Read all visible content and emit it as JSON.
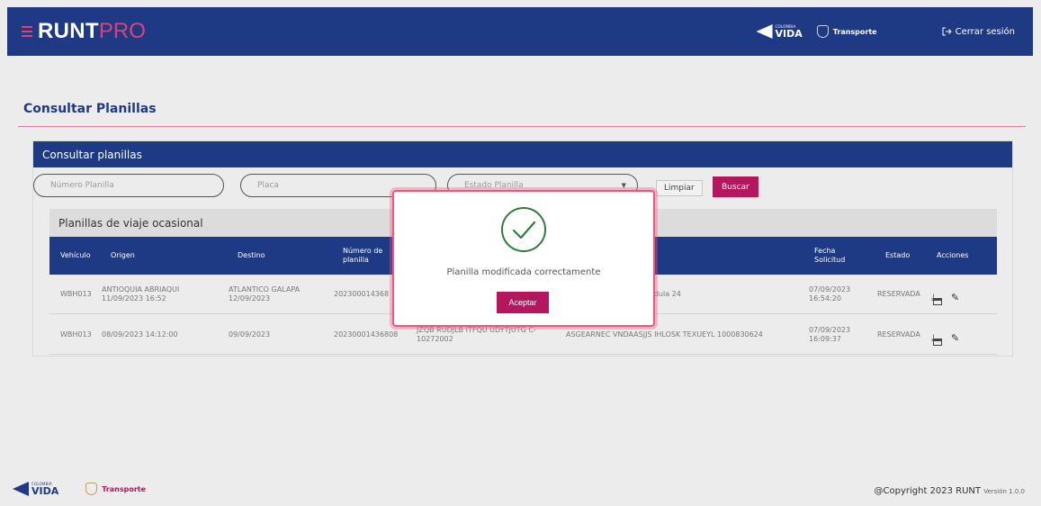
{
  "header": {
    "logo_main": "RUNT",
    "logo_suffix": "PRO",
    "partner_small": "COLOMBIA",
    "partner_big": "VIDA",
    "ministry": "Transporte",
    "logout_label": "Cerrar sesión",
    "logout_icon": "logout-icon"
  },
  "page": {
    "title": "Consultar Planillas"
  },
  "card": {
    "header": "Consultar planillas",
    "filters": {
      "numero_placeholder": "Número Planilla",
      "placa_placeholder": "Placa",
      "estado_placeholder": "Estado Planilla"
    },
    "clear_label": "Limpiar",
    "search_label": "Buscar"
  },
  "table": {
    "section_title": "Planillas de viaje ocasional",
    "headers": {
      "vehiculo": "Vehículo",
      "origen": "Origen",
      "destino": "Destino",
      "numero": "Número de planilla",
      "fecha": "Fecha Solicitud",
      "estado": "Estado",
      "acciones": "Acciones"
    },
    "rows": [
      {
        "vehiculo": "WBH013",
        "origen": "ANTIOQUIA ABRIAQUI 11/09/2023 16:52",
        "destino": "ATLANTICO GALAPA 12/09/2023",
        "numero": "202300014368",
        "conductor": "",
        "contratante": "SJJS IHLOSK TEXUEYL Cédula 24",
        "fecha": "07/09/2023 16:54:20",
        "estado": "RESERVADA"
      },
      {
        "vehiculo": "WBH013",
        "origen": "08/09/2023 14:12:00",
        "destino": "09/09/2023",
        "numero": "20230001436808",
        "conductor": "JZQB RUDJLB ITFQU UDYTJUTG C- 10272002",
        "contratante": "ASGEARNEC VNDAASJJS IHLOSK TEXUEYL 1000830624",
        "fecha": "07/09/2023 16:09:37",
        "estado": "RESERVADA"
      }
    ]
  },
  "modal": {
    "icon": "check-circle-icon",
    "message": "Planilla modificada correctamente",
    "accept_label": "Aceptar"
  },
  "footer": {
    "copyright": "@Copyright 2023 RUNT",
    "version": "Versión 1.0.0"
  },
  "colors": {
    "primary": "#1f3a84",
    "accent": "#b5175f",
    "modal_border": "#f0567f"
  }
}
